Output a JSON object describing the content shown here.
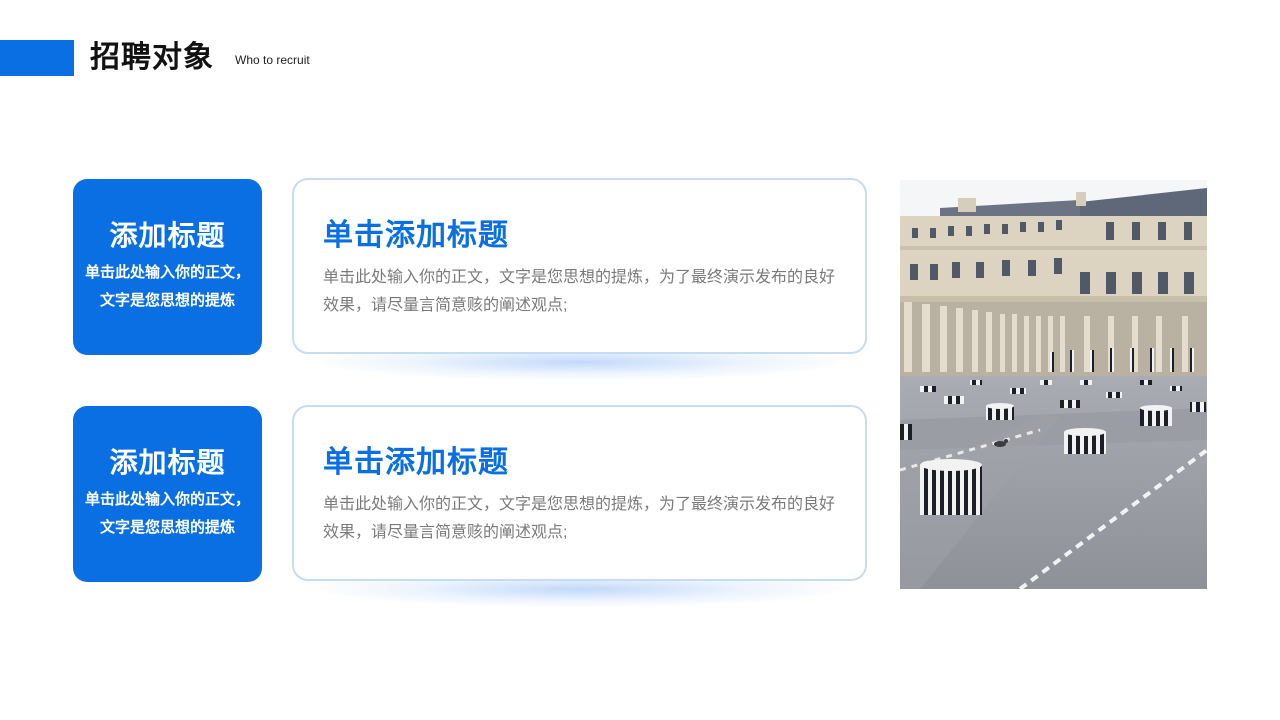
{
  "header": {
    "title": "招聘对象",
    "subtitle": "Who to recruit",
    "accent_color": "#0a6fe3"
  },
  "rows": [
    {
      "side_title": "添加标题",
      "side_body_line1": "单击此处输入你的正文，",
      "side_body_line2": "文字是您思想的提炼",
      "card_title": "单击添加标题",
      "card_body": "单击此处输入你的正文，文字是您思想的提炼，为了最终演示发布的良好效果，请尽量言简意赅的阐述观点;"
    },
    {
      "side_title": "添加标题",
      "side_body_line1": "单击此处输入你的正文，",
      "side_body_line2": "文字是您思想的提炼",
      "card_title": "单击添加标题",
      "card_body": "单击此处输入你的正文，文字是您思想的提炼，为了最终演示发布的良好效果，请尽量言简意赅的阐述观点;"
    }
  ],
  "photo": {
    "icon": "photo-courtyard-columns"
  }
}
